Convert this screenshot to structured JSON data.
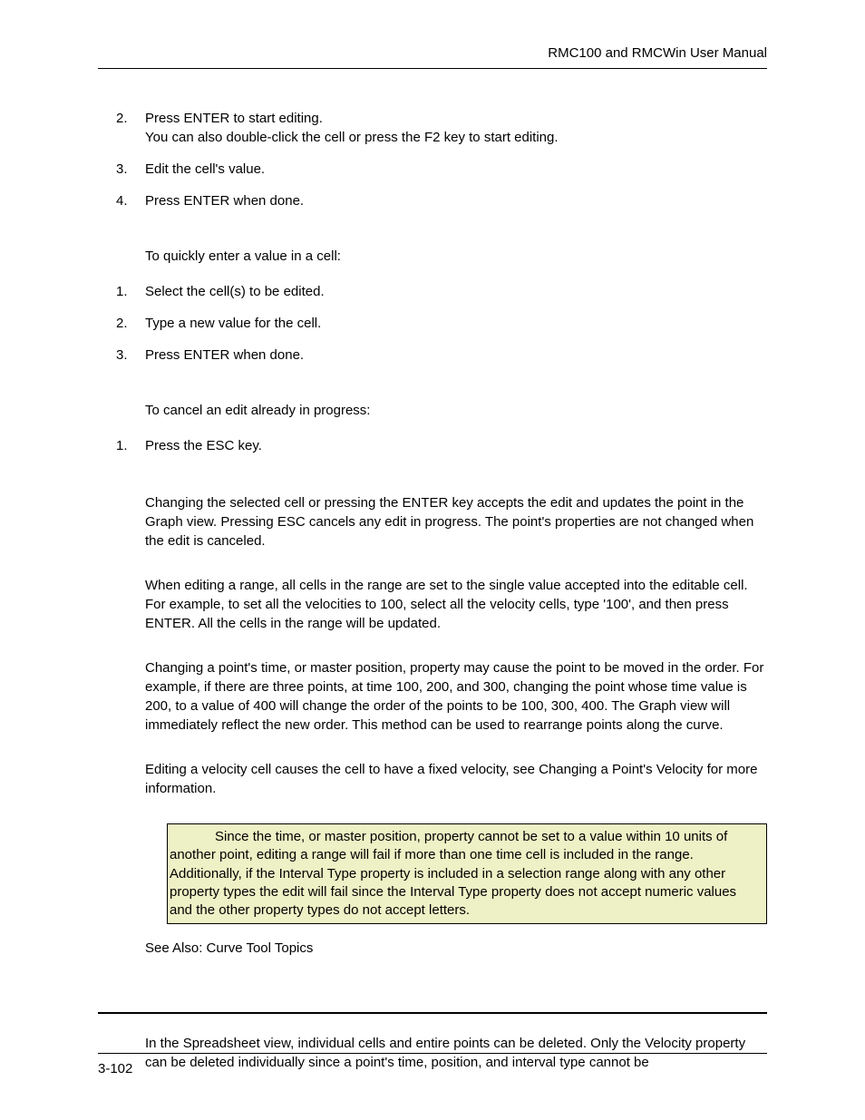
{
  "header": {
    "title": "RMC100 and RMCWin User Manual"
  },
  "list1": {
    "items": [
      {
        "num": "2.",
        "line1": "Press ENTER to start editing.",
        "line2": "You can also double-click the cell or press the F2 key to start editing."
      },
      {
        "num": "3.",
        "line1": "Edit the cell's value."
      },
      {
        "num": "4.",
        "line1": "Press ENTER when done."
      }
    ]
  },
  "intro2": "To quickly enter a value in a cell:",
  "list2": {
    "items": [
      {
        "num": "1.",
        "line1": "Select the cell(s) to be edited."
      },
      {
        "num": "2.",
        "line1": "Type a new value for the cell."
      },
      {
        "num": "3.",
        "line1": "Press ENTER when done."
      }
    ]
  },
  "intro3": "To cancel an edit already in progress:",
  "list3": {
    "items": [
      {
        "num": "1.",
        "line1": "Press the ESC key."
      }
    ]
  },
  "para1": "Changing the selected cell or pressing the ENTER key accepts the edit and updates the point in the Graph view. Pressing ESC cancels any edit in progress. The point's properties are not changed when the edit is canceled.",
  "para2": "When editing a range, all cells in the range are set to the single value accepted into the editable cell. For example, to set all the velocities to 100, select all the velocity cells, type '100', and then press ENTER. All the cells in the range will be updated.",
  "para3": "Changing a point's time, or master position, property may cause the point to be moved in the order. For example, if there are three points, at time 100, 200, and 300, changing the point whose time value is 200, to a value of 400 will change the order of the points to be 100, 300, 400. The Graph view will immediately reflect the new order. This method can be used to rearrange points along the curve.",
  "para4": "Editing a velocity cell causes the cell to have a fixed velocity, see Changing a Point's Velocity for more information.",
  "note": "Since the time, or master position, property cannot be set to a value within 10 units of another point, editing a range will fail if more than one time cell is included in the range. Additionally, if the Interval Type property is included in a selection range along with any other property types the edit will fail since the Interval Type property does not accept numeric values and the other property types do not accept letters.",
  "seeAlso": "See Also: Curve Tool Topics",
  "para5": "In the Spreadsheet view, individual cells and entire points can be deleted. Only the Velocity property can be deleted individually since a point's time, position, and interval type cannot be",
  "footer": {
    "pageNum": "3-102"
  }
}
